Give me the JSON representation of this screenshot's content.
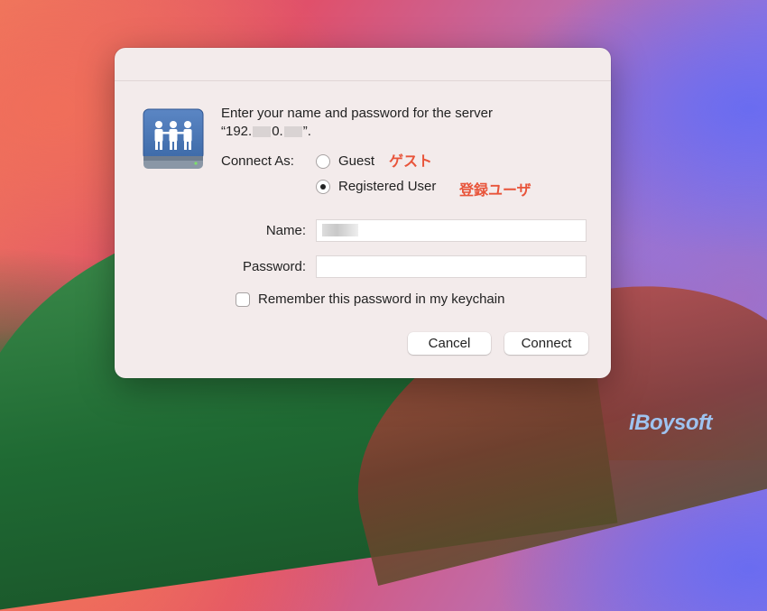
{
  "dialog": {
    "prompt_line1": "Enter your name and password for the server",
    "prompt_line2_prefix": "“192.",
    "prompt_line2_mid": "0.",
    "prompt_line2_suffix": "”.",
    "connect_as_label": "Connect As:",
    "radio_guest_label": "Guest",
    "radio_guest_annotation": "ゲスト",
    "radio_registered_label": "Registered User",
    "radio_registered_annotation": "登録ユーザ",
    "selected_option": "Registered User",
    "name_label": "Name:",
    "name_value": "",
    "password_label": "Password:",
    "password_value": "",
    "remember_label": "Remember this password in my keychain",
    "remember_checked": false,
    "cancel_label": "Cancel",
    "connect_label": "Connect"
  },
  "watermark": "iBoysoft",
  "colors": {
    "annotation": "#e8543a",
    "dialog_bg": "#f3ebeb",
    "watermark": "#9ec3f0"
  },
  "icons": {
    "server": "network-server-icon"
  }
}
